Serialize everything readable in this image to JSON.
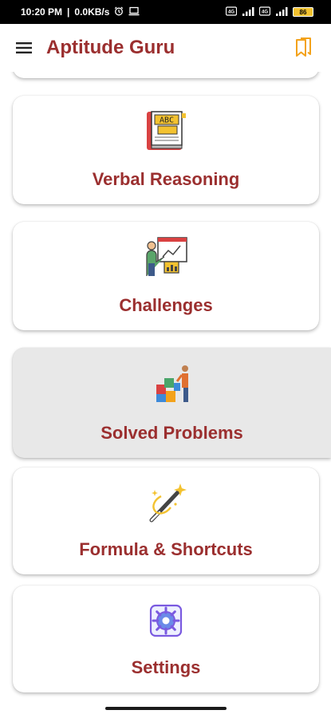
{
  "status_bar": {
    "time": "10:20 PM",
    "net_speed": "0.0KB/s",
    "battery": "86"
  },
  "app": {
    "title": "Aptitude Guru",
    "brand_color": "#9b2f2f",
    "accent_color": "#f3a21b"
  },
  "menu": [
    {
      "label": "Verbal Reasoning",
      "icon": "abc-book-icon"
    },
    {
      "label": "Challenges",
      "icon": "presentation-icon"
    },
    {
      "label": "Solved Problems",
      "icon": "puzzle-person-icon",
      "active": true
    },
    {
      "label": "Formula & Shortcuts",
      "icon": "magic-wand-icon"
    },
    {
      "label": "Settings",
      "icon": "settings-gear-icon"
    }
  ]
}
